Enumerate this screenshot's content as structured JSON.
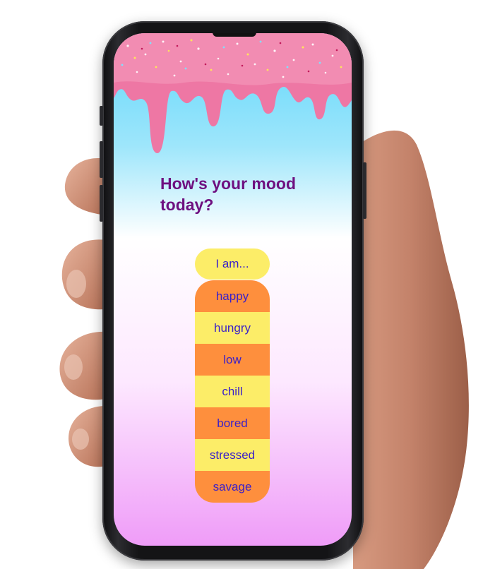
{
  "screen": {
    "title": "How's your mood today?",
    "prompt": "I am...",
    "moods": [
      "happy",
      "hungry",
      "low",
      "chill",
      "bored",
      "stressed",
      "savage"
    ]
  },
  "colors": {
    "title_text": "#6e1080",
    "option_text": "#3a1fc9",
    "orange": "#fe8f3d",
    "yellow": "#fced68",
    "frosting": "#ee77a4",
    "gradient_top": "#5fd6fb",
    "gradient_bottom": "#ef9cf8"
  },
  "icons": [
    "frosting-drip-illustration",
    "hand-illustration"
  ]
}
